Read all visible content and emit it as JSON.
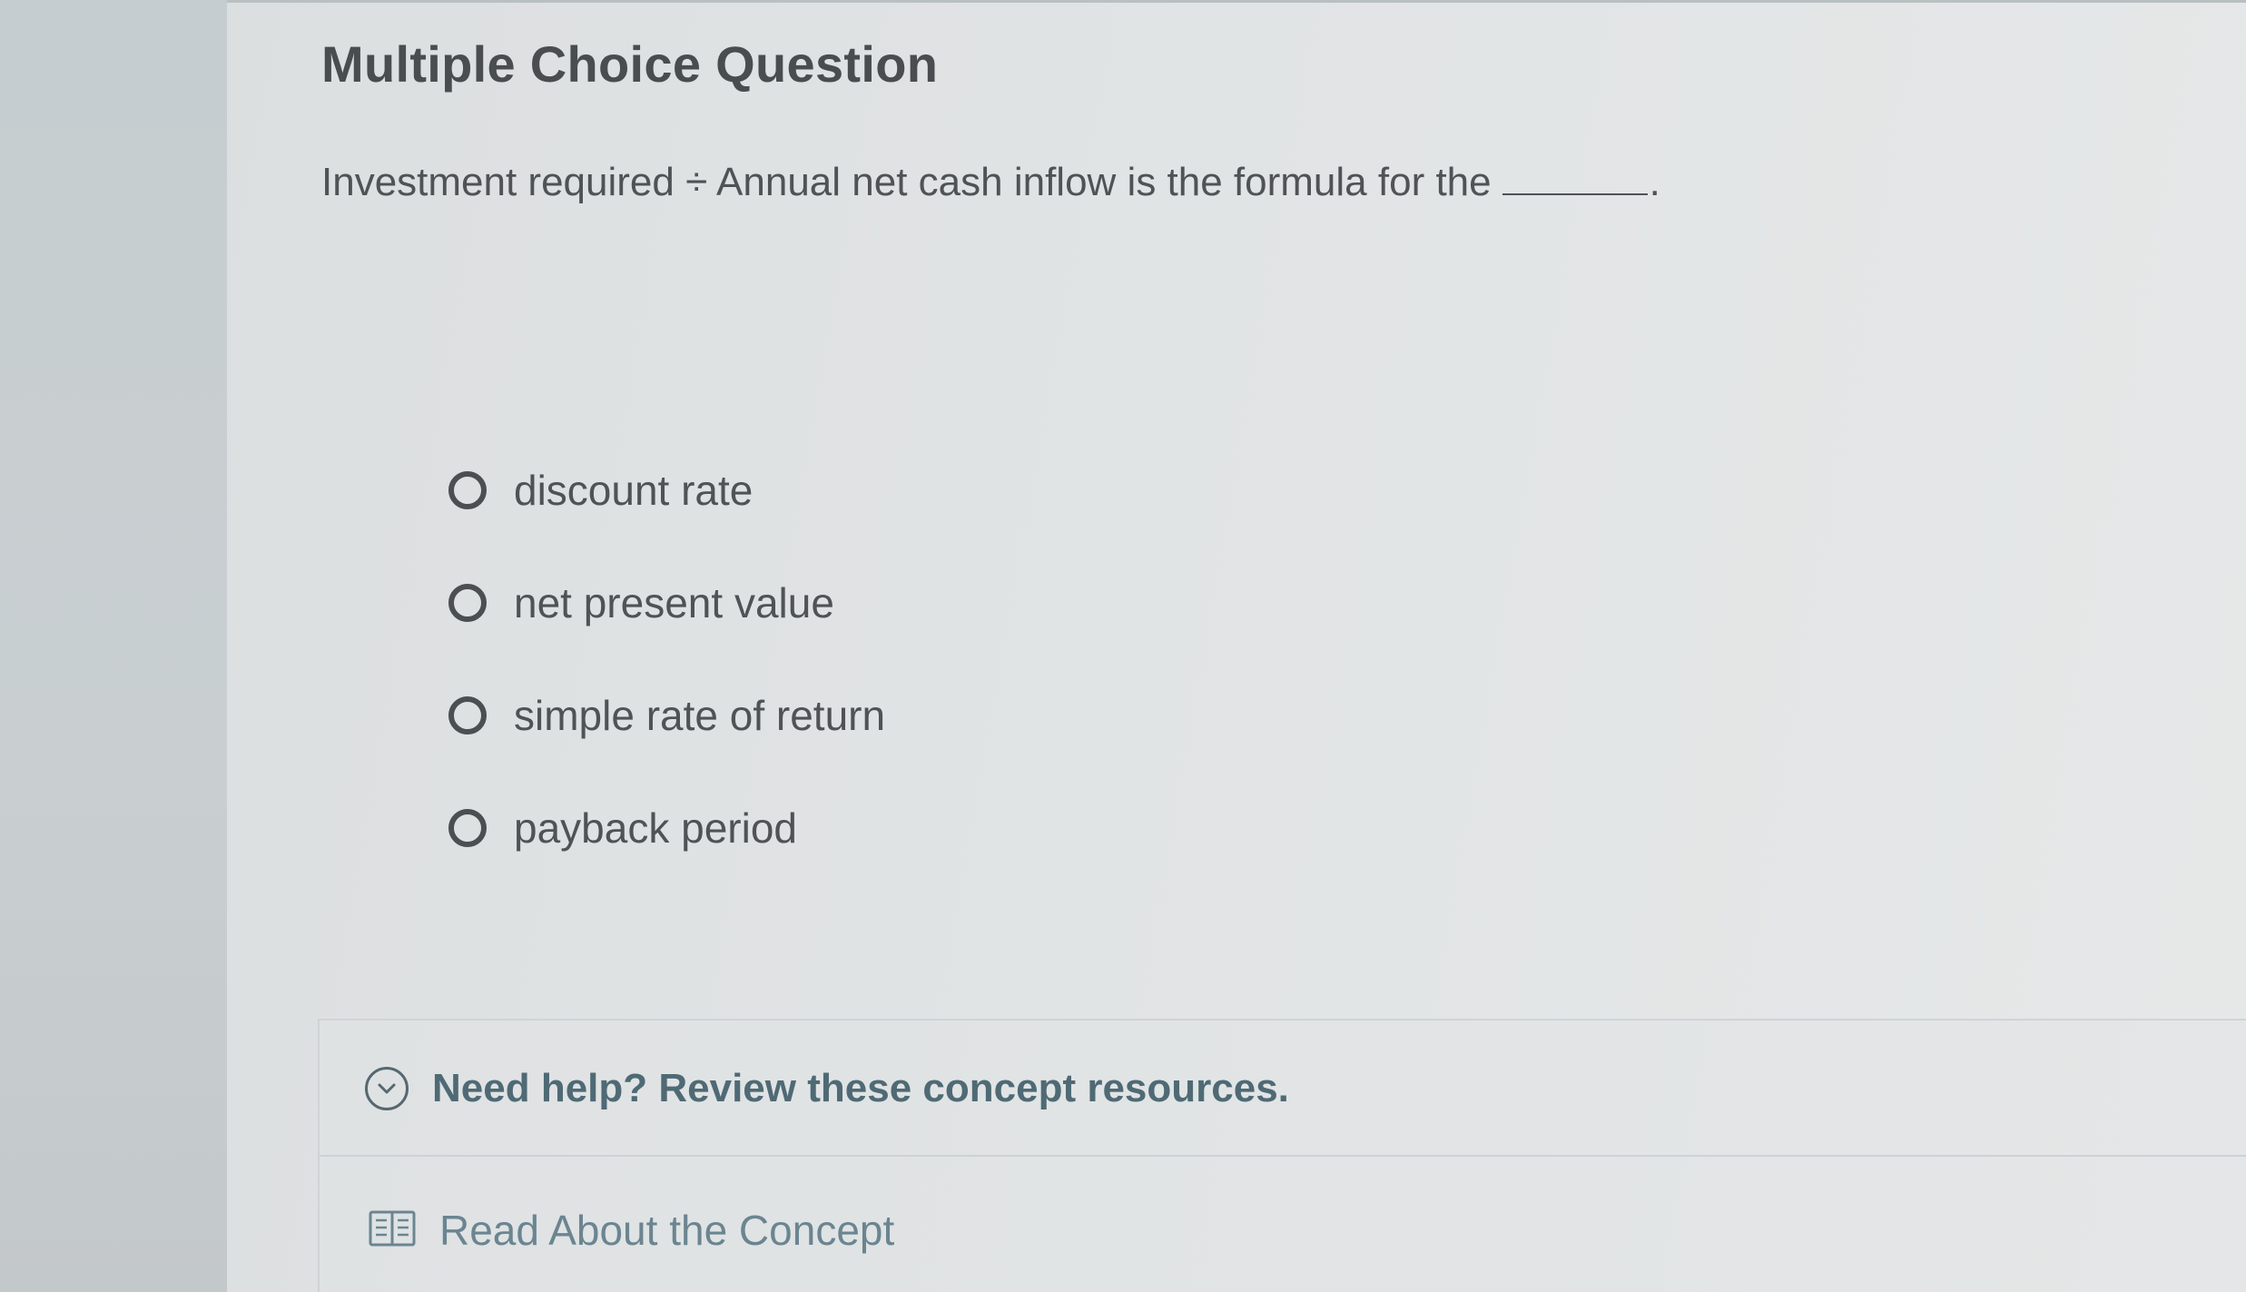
{
  "question": {
    "heading": "Multiple Choice Question",
    "prompt": "Investment required ÷ Annual net cash inflow is the formula for the",
    "blank_end": ".",
    "options": [
      {
        "label": "discount rate"
      },
      {
        "label": "net present value"
      },
      {
        "label": "simple rate of return"
      },
      {
        "label": "payback period"
      }
    ]
  },
  "help": {
    "toggle_label": "Need help? Review these concept resources.",
    "read_label": "Read About the Concept",
    "toggle_icon": "chevron-down-circle-icon",
    "read_icon": "book-icon",
    "link_color": "#4f6a75"
  }
}
